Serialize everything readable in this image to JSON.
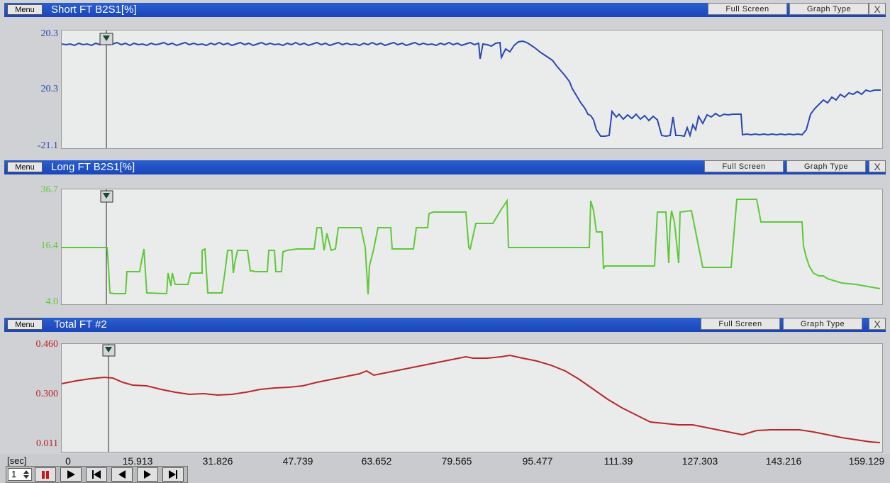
{
  "panels": [
    {
      "menu_label": "Menu",
      "title": "Short FT B2S1[%]",
      "full_screen_label": "Full Screen",
      "graph_type_label": "Graph Type",
      "close_label": "X",
      "y_labels": [
        "20.3",
        "20.3",
        "-21.1"
      ],
      "color": "#2a48b0"
    },
    {
      "menu_label": "Menu",
      "title": "Long FT B2S1[%]",
      "full_screen_label": "Full Screen",
      "graph_type_label": "Graph Type",
      "close_label": "X",
      "y_labels": [
        "36.7",
        "16.4",
        "4.0"
      ],
      "color": "#5fc83a"
    },
    {
      "menu_label": "Menu",
      "title": "Total FT #2",
      "full_screen_label": "Full Screen",
      "graph_type_label": "Graph Type",
      "close_label": "X",
      "y_labels": [
        "0.460",
        "0.300",
        "0.011"
      ],
      "color": "#b8282a"
    }
  ],
  "x_axis": {
    "unit": "[sec]",
    "ticks": [
      "0",
      "15.913",
      "31.826",
      "47.739",
      "63.652",
      "79.565",
      "95.477",
      "111.39",
      "127.303",
      "143.216",
      "159.129"
    ]
  },
  "controls": {
    "speed_value": "1",
    "buttons": [
      "pause-icon",
      "play-icon",
      "step-back-icon",
      "rewind-icon",
      "forward-icon",
      "step-forward-icon"
    ]
  },
  "cursor_time": 5.2
}
